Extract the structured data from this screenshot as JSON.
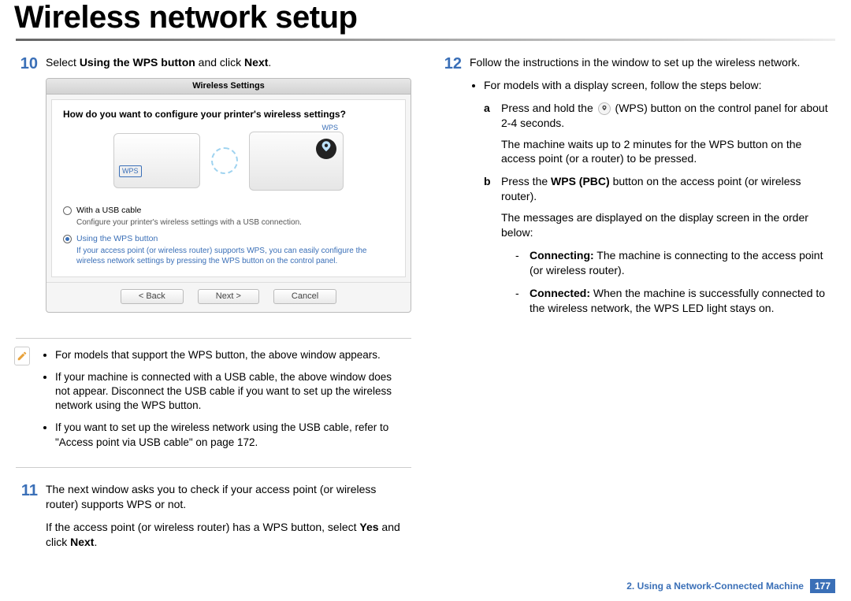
{
  "title": "Wireless network setup",
  "colA": {
    "step10": {
      "num": "10",
      "pre": "Select ",
      "boldA": "Using the WPS button",
      "mid": " and click ",
      "boldB": "Next",
      "post": "."
    },
    "dialog": {
      "titlebar": "Wireless Settings",
      "question": "How do you want to configure your printer's wireless settings?",
      "wpsBadge": "WPS",
      "opt1_label": "With a USB cable",
      "opt1_desc": "Configure your printer's wireless settings with a USB connection.",
      "opt2_label": "Using the WPS button",
      "opt2_desc": "If your access point (or wireless router) supports WPS, you can easily configure the wireless network settings by pressing the WPS button on the control panel.",
      "btn_back": "< Back",
      "btn_next": "Next >",
      "btn_cancel": "Cancel"
    },
    "note": {
      "b1": "For models that support the WPS button, the above window appears.",
      "b2": "If your machine is connected with a USB cable, the above window does not appear. Disconnect the USB cable if you want to set up the wireless network using the WPS button.",
      "b3": "If you want to set up the wireless network using the USB cable, refer to \"Access point via USB cable\" on page 172."
    },
    "step11": {
      "num": "11",
      "p1": "The next window asks you to check if your access point (or wireless router) supports WPS or not.",
      "p2_pre": "If the access point (or wireless router) has a WPS button, select ",
      "p2_bold1": "Yes",
      "p2_mid": " and click ",
      "p2_bold2": "Next",
      "p2_post": "."
    }
  },
  "colB": {
    "step12": {
      "num": "12",
      "p1": "Follow the instructions in the window to set up the wireless network.",
      "bullet1": "For models with a display screen, follow the steps below:",
      "a_pre": "Press and hold the ",
      "a_post": " (WPS) button on the control panel for about 2-4 seconds.",
      "a2": "The machine waits up to 2 minutes for the WPS button on the access point (or a router) to be pressed.",
      "b_pre": "Press the ",
      "b_bold": "WPS (PBC)",
      "b_post": " button on the access point (or wireless router).",
      "b2": "The messages are displayed on the display screen in the order below:",
      "d1_bold": "Connecting:",
      "d1_rest": " The machine is connecting to the access point (or wireless router).",
      "d2_bold": "Connected:",
      "d2_rest": " When the machine is successfully connected to the wireless network, the WPS LED light stays on."
    }
  },
  "footer": {
    "chapter": "2.  Using a Network-Connected Machine",
    "page": "177"
  }
}
